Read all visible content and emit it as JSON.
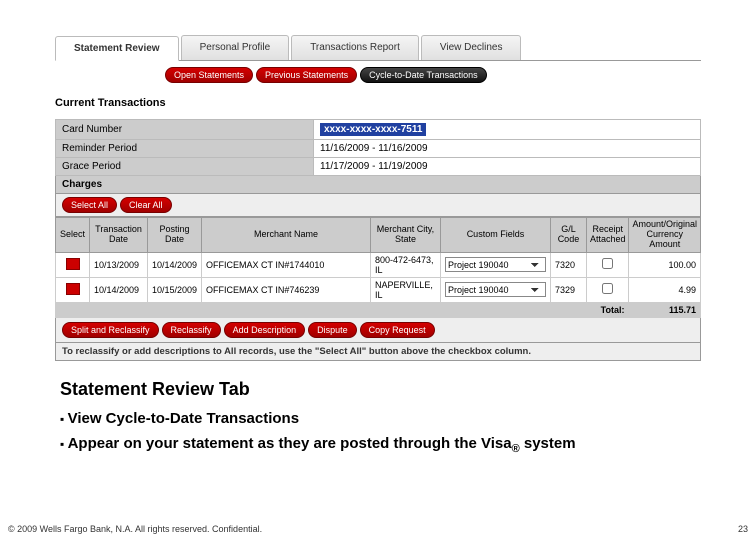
{
  "tabs": [
    "Statement Review",
    "Personal Profile",
    "Transactions Report",
    "View Declines"
  ],
  "subtabs": {
    "open": "Open Statements",
    "prev": "Previous Statements",
    "cycle": "Cycle-to-Date Transactions"
  },
  "section_title": "Current Transactions",
  "info": {
    "card_label": "Card Number",
    "card_value": "xxxx-xxxx-xxxx-7511",
    "reminder_label": "Reminder Period",
    "reminder_value": "11/16/2009 - 11/16/2009",
    "grace_label": "Grace Period",
    "grace_value": "11/17/2009 - 11/19/2009"
  },
  "charges_label": "Charges",
  "buttons": {
    "select_all": "Select All",
    "clear_all": "Clear All",
    "split": "Split and Reclassify",
    "reclass": "Reclassify",
    "add_desc": "Add Description",
    "dispute": "Dispute",
    "copy": "Copy Request"
  },
  "headers": {
    "select": "Select",
    "tx_date": "Transaction Date",
    "post_date": "Posting Date",
    "merchant": "Merchant Name",
    "city": "Merchant City, State",
    "custom": "Custom Fields",
    "gl": "G/L Code",
    "receipt": "Receipt Attached",
    "amount": "Amount/Original Currency Amount"
  },
  "rows": [
    {
      "tx": "10/13/2009",
      "post": "10/14/2009",
      "merchant": "OFFICEMAX CT IN#1744010",
      "city": "800-472-6473, IL",
      "custom": "Project 190040",
      "gl": "7320",
      "amt": "100.00"
    },
    {
      "tx": "10/14/2009",
      "post": "10/15/2009",
      "merchant": "OFFICEMAX CT IN#746239",
      "city": "NAPERVILLE, IL",
      "custom": "Project 190040",
      "gl": "7329",
      "amt": "4.99"
    }
  ],
  "total_label": "Total:",
  "total_value": "115.71",
  "hint": "To reclassify or add descriptions to All records, use the \"Select All\" button above the checkbox column.",
  "slide": {
    "title": "Statement Review Tab",
    "b1": "View Cycle-to-Date Transactions",
    "b2_a": "Appear on your statement as they are posted through the Visa",
    "b2_b": "system"
  },
  "footer": {
    "copy": "© 2009 Wells Fargo Bank, N.A. All rights reserved. Confidential.",
    "page": "23"
  }
}
